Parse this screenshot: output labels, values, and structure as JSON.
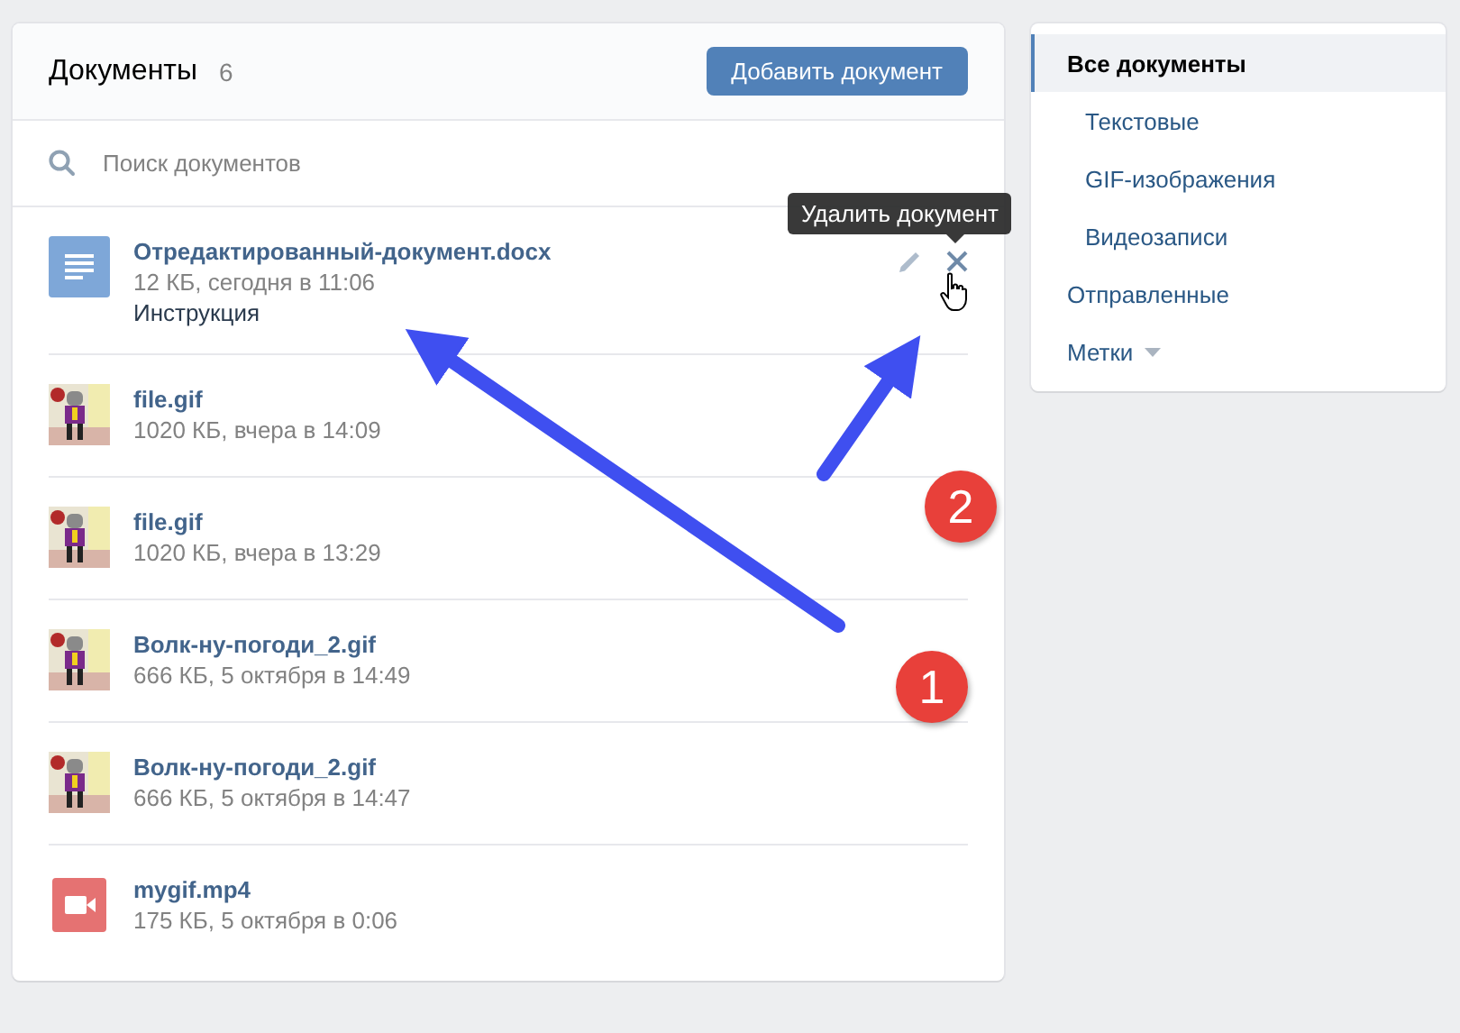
{
  "header": {
    "title": "Документы",
    "count": "6",
    "add_button": "Добавить документ"
  },
  "search": {
    "placeholder": "Поиск документов"
  },
  "documents": [
    {
      "kind": "doc",
      "name": "Отредактированный-документ.docx",
      "meta": "12 КБ, сегодня в 11:06",
      "description": "Инструкция",
      "actions": [
        {
          "kind": "edit"
        },
        {
          "kind": "delete",
          "tooltip": "Удалить документ"
        }
      ]
    },
    {
      "kind": "gif",
      "name": "file.gif",
      "meta": "1020 КБ, вчера в 14:09"
    },
    {
      "kind": "gif",
      "name": "file.gif",
      "meta": "1020 КБ, вчера в 13:29"
    },
    {
      "kind": "gif",
      "name": "Волк-ну-погоди_2.gif",
      "meta": "666 КБ, 5 октября в 14:49"
    },
    {
      "kind": "gif",
      "name": "Волк-ну-погоди_2.gif",
      "meta": "666 КБ, 5 октября в 14:47"
    },
    {
      "kind": "video",
      "name": "mygif.mp4",
      "meta": "175 КБ, 5 октября в 0:06"
    }
  ],
  "sidebar": {
    "items": [
      {
        "label": "Все документы",
        "selected": true,
        "indent": false,
        "kind": "link"
      },
      {
        "label": "Текстовые",
        "selected": false,
        "indent": true,
        "kind": "link"
      },
      {
        "label": "GIF-изображения",
        "selected": false,
        "indent": true,
        "kind": "link"
      },
      {
        "label": "Видеозаписи",
        "selected": false,
        "indent": true,
        "kind": "link"
      },
      {
        "label": "Отправленные",
        "selected": false,
        "indent": false,
        "kind": "link"
      },
      {
        "label": "Метки",
        "selected": false,
        "indent": false,
        "kind": "dropdown"
      }
    ]
  },
  "annotations": [
    {
      "label": "2"
    },
    {
      "label": "1"
    }
  ]
}
